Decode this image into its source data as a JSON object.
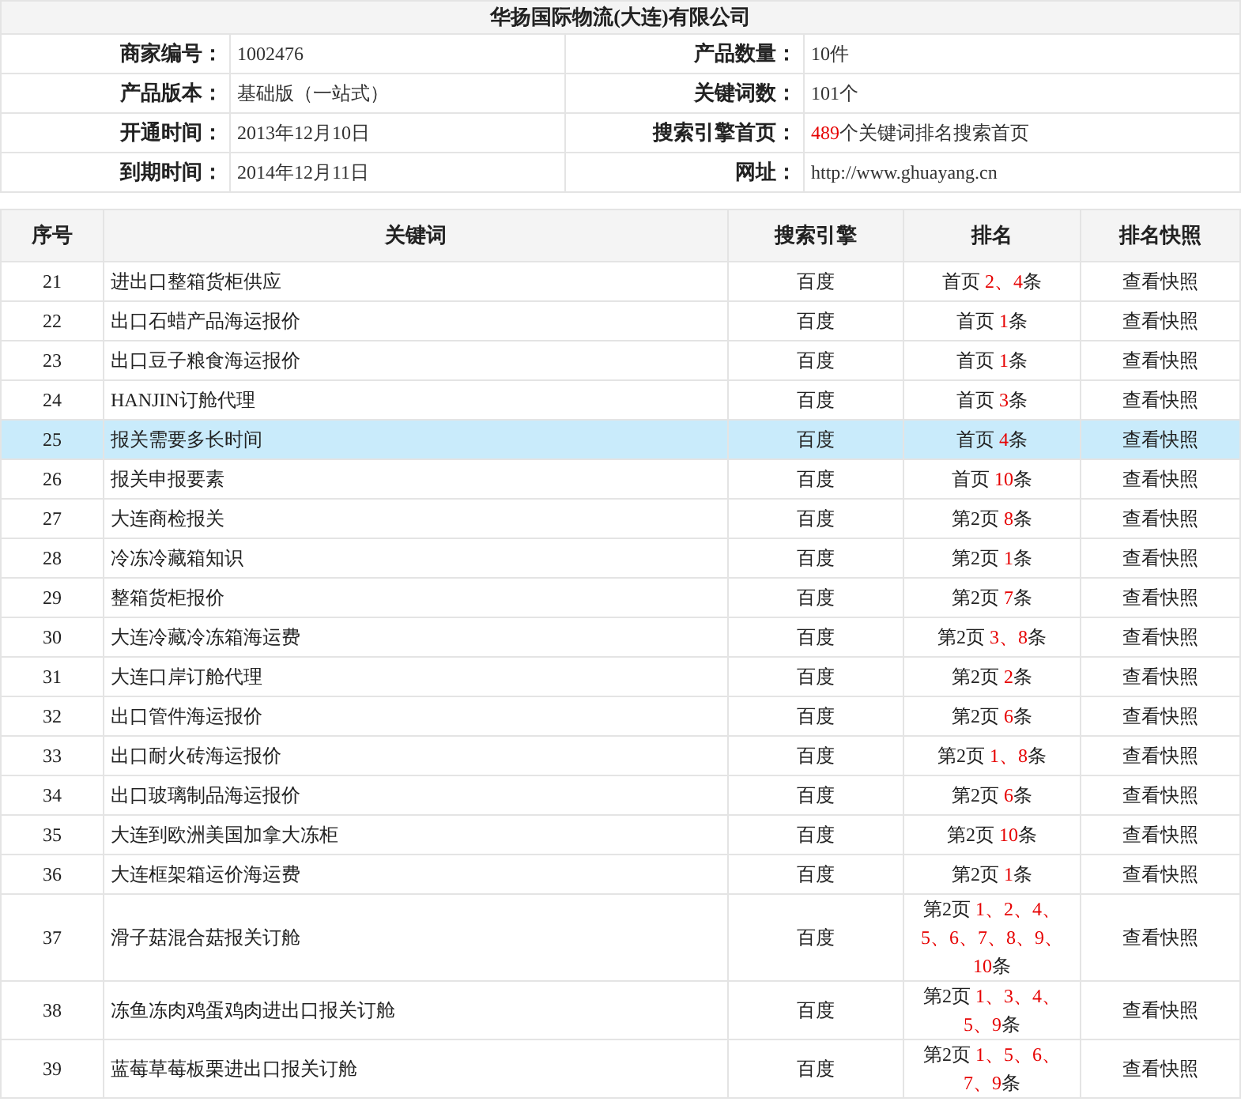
{
  "title": "华扬国际物流(大连)有限公司",
  "info": [
    {
      "label": "商家编号：",
      "value": "1002476",
      "label2": "产品数量：",
      "value2": "10件"
    },
    {
      "label": "产品版本：",
      "value": "基础版（一站式）",
      "label2": "关键词数：",
      "value2": "101个"
    },
    {
      "label": "开通时间：",
      "value": "2013年12月10日",
      "label2": "搜索引擎首页：",
      "value2_highlight": "489",
      "value2": "个关键词排名搜索首页"
    },
    {
      "label": "到期时间：",
      "value": "2014年12月11日",
      "label2": "网址：",
      "value2": "http://www.ghuayang.cn"
    }
  ],
  "table": {
    "columns": [
      "序号",
      "关键词",
      "搜索引擎",
      "排名",
      "排名快照"
    ],
    "rows": [
      {
        "no": "21",
        "keyword": "进出口整箱货柜供应",
        "engine": "百度",
        "page": "首页",
        "positions": "2、4",
        "unit": "条",
        "snapshot": "查看快照",
        "selected": false
      },
      {
        "no": "22",
        "keyword": "出口石蜡产品海运报价",
        "engine": "百度",
        "page": "首页",
        "positions": "1",
        "unit": "条",
        "snapshot": "查看快照",
        "selected": false
      },
      {
        "no": "23",
        "keyword": "出口豆子粮食海运报价",
        "engine": "百度",
        "page": "首页",
        "positions": "1",
        "unit": "条",
        "snapshot": "查看快照",
        "selected": false
      },
      {
        "no": "24",
        "keyword": "HANJIN订舱代理",
        "engine": "百度",
        "page": "首页",
        "positions": "3",
        "unit": "条",
        "snapshot": "查看快照",
        "selected": false
      },
      {
        "no": "25",
        "keyword": "报关需要多长时间",
        "engine": "百度",
        "page": "首页",
        "positions": "4",
        "unit": "条",
        "snapshot": "查看快照",
        "selected": true
      },
      {
        "no": "26",
        "keyword": "报关申报要素",
        "engine": "百度",
        "page": "首页",
        "positions": "10",
        "unit": "条",
        "snapshot": "查看快照",
        "selected": false
      },
      {
        "no": "27",
        "keyword": "大连商检报关",
        "engine": "百度",
        "page": "第2页",
        "positions": "8",
        "unit": "条",
        "snapshot": "查看快照",
        "selected": false
      },
      {
        "no": "28",
        "keyword": "冷冻冷藏箱知识",
        "engine": "百度",
        "page": "第2页",
        "positions": "1",
        "unit": "条",
        "snapshot": "查看快照",
        "selected": false
      },
      {
        "no": "29",
        "keyword": "整箱货柜报价",
        "engine": "百度",
        "page": "第2页",
        "positions": "7",
        "unit": "条",
        "snapshot": "查看快照",
        "selected": false
      },
      {
        "no": "30",
        "keyword": "大连冷藏冷冻箱海运费",
        "engine": "百度",
        "page": "第2页",
        "positions": "3、8",
        "unit": "条",
        "snapshot": "查看快照",
        "selected": false
      },
      {
        "no": "31",
        "keyword": "大连口岸订舱代理",
        "engine": "百度",
        "page": "第2页",
        "positions": "2",
        "unit": "条",
        "snapshot": "查看快照",
        "selected": false
      },
      {
        "no": "32",
        "keyword": "出口管件海运报价",
        "engine": "百度",
        "page": "第2页",
        "positions": "6",
        "unit": "条",
        "snapshot": "查看快照",
        "selected": false
      },
      {
        "no": "33",
        "keyword": "出口耐火砖海运报价",
        "engine": "百度",
        "page": "第2页",
        "positions": "1、8",
        "unit": "条",
        "snapshot": "查看快照",
        "selected": false
      },
      {
        "no": "34",
        "keyword": "出口玻璃制品海运报价",
        "engine": "百度",
        "page": "第2页",
        "positions": "6",
        "unit": "条",
        "snapshot": "查看快照",
        "selected": false
      },
      {
        "no": "35",
        "keyword": "大连到欧洲美国加拿大冻柜",
        "engine": "百度",
        "page": "第2页",
        "positions": "10",
        "unit": "条",
        "snapshot": "查看快照",
        "selected": false
      },
      {
        "no": "36",
        "keyword": "大连框架箱运价海运费",
        "engine": "百度",
        "page": "第2页",
        "positions": "1",
        "unit": "条",
        "snapshot": "查看快照",
        "selected": false
      },
      {
        "no": "37",
        "keyword": "滑子菇混合菇报关订舱",
        "engine": "百度",
        "page": "第2页",
        "positions": "1、2、4、5、6、7、8、9、10",
        "unit": "条",
        "snapshot": "查看快照",
        "selected": false
      },
      {
        "no": "38",
        "keyword": "冻鱼冻肉鸡蛋鸡肉进出口报关订舱",
        "engine": "百度",
        "page": "第2页",
        "positions": "1、3、4、5、9",
        "unit": "条",
        "snapshot": "查看快照",
        "selected": false
      },
      {
        "no": "39",
        "keyword": "蓝莓草莓板栗进出口报关订舱",
        "engine": "百度",
        "page": "第2页",
        "positions": "1、5、6、7、9",
        "unit": "条",
        "snapshot": "查看快照",
        "selected": false
      }
    ]
  }
}
